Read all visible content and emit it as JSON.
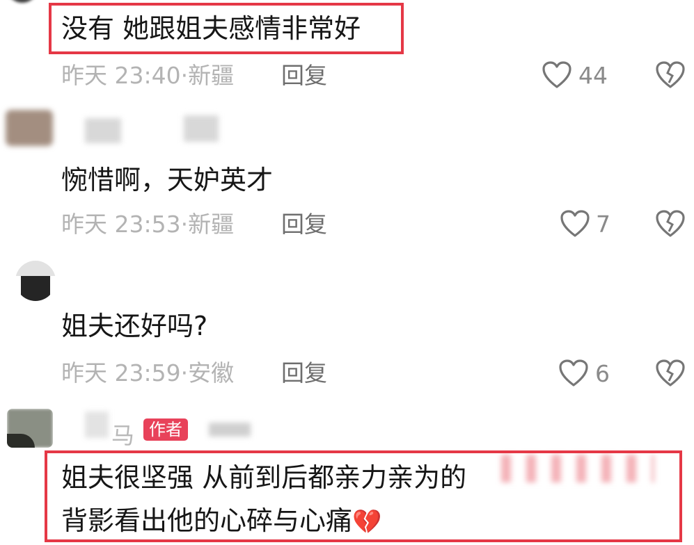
{
  "comments": [
    {
      "text": "没有 她跟姐夫感情非常好",
      "time": "昨天 23:40·新疆",
      "reply": "回复",
      "likes": "44"
    },
    {
      "text": "惋惜啊，天妒英才",
      "time": "昨天 23:53·新疆",
      "reply": "回复",
      "likes": "7"
    },
    {
      "text": "姐夫还好吗?",
      "time": "昨天 23:59·安徽",
      "reply": "回复",
      "likes": "6"
    },
    {
      "user": "马",
      "badge": "作者",
      "text_line1": "姐夫很坚强 从前到后都亲力亲为的",
      "text_line2": "背影看出他的心碎与心痛",
      "emoji": "💔"
    }
  ],
  "colors": {
    "highlight": "#e53846",
    "badge": "#e8425a"
  }
}
